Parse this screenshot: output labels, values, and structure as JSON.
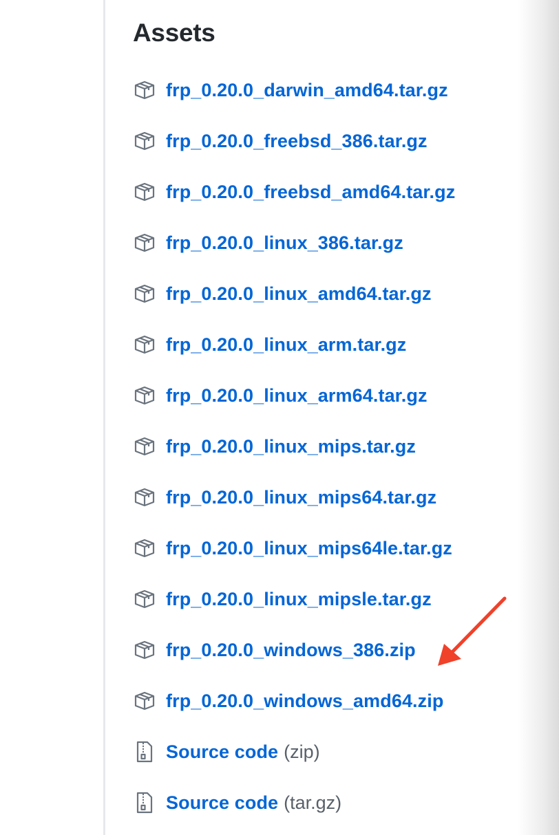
{
  "section": {
    "title": "Assets"
  },
  "assets": [
    {
      "label": "frp_0.20.0_darwin_amd64.tar.gz",
      "icon": "package-icon"
    },
    {
      "label": "frp_0.20.0_freebsd_386.tar.gz",
      "icon": "package-icon"
    },
    {
      "label": "frp_0.20.0_freebsd_amd64.tar.gz",
      "icon": "package-icon"
    },
    {
      "label": "frp_0.20.0_linux_386.tar.gz",
      "icon": "package-icon"
    },
    {
      "label": "frp_0.20.0_linux_amd64.tar.gz",
      "icon": "package-icon"
    },
    {
      "label": "frp_0.20.0_linux_arm.tar.gz",
      "icon": "package-icon"
    },
    {
      "label": "frp_0.20.0_linux_arm64.tar.gz",
      "icon": "package-icon"
    },
    {
      "label": "frp_0.20.0_linux_mips.tar.gz",
      "icon": "package-icon"
    },
    {
      "label": "frp_0.20.0_linux_mips64.tar.gz",
      "icon": "package-icon"
    },
    {
      "label": "frp_0.20.0_linux_mips64le.tar.gz",
      "icon": "package-icon"
    },
    {
      "label": "frp_0.20.0_linux_mipsle.tar.gz",
      "icon": "package-icon"
    },
    {
      "label": "frp_0.20.0_windows_386.zip",
      "icon": "package-icon"
    },
    {
      "label": "frp_0.20.0_windows_amd64.zip",
      "icon": "package-icon"
    }
  ],
  "source_code": [
    {
      "label": "Source code",
      "suffix": "(zip)",
      "icon": "file-zip-icon"
    },
    {
      "label": "Source code",
      "suffix": "(tar.gz)",
      "icon": "file-zip-icon"
    }
  ],
  "colors": {
    "link": "#0366d6",
    "title": "#24292e",
    "muted": "#586069",
    "icon": "#6a737d",
    "annotation_arrow": "#f0412a"
  }
}
